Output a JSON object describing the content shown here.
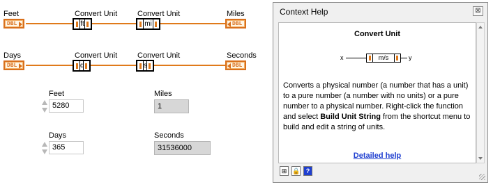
{
  "diagram": {
    "row1": {
      "input_label": "Feet",
      "node1_header": "Convert Unit",
      "node1_unit": "ft",
      "node2_header": "Convert Unit",
      "node2_unit": "mi",
      "output_label": "Miles"
    },
    "row2": {
      "input_label": "Days",
      "node1_header": "Convert Unit",
      "node1_unit": "d",
      "node2_header": "Convert Unit",
      "node2_unit": "s",
      "output_label": "Seconds"
    },
    "terminal_type": "DBL",
    "wire_color": "#e07a1a"
  },
  "front_panel": {
    "feet": {
      "label": "Feet",
      "value": "5280"
    },
    "miles": {
      "label": "Miles",
      "value": "1"
    },
    "days": {
      "label": "Days",
      "value": "365"
    },
    "seconds": {
      "label": "Seconds",
      "value": "31536000"
    }
  },
  "context_help": {
    "window_title": "Context Help",
    "heading": "Convert Unit",
    "diagram": {
      "input": "x",
      "unit": "m/s",
      "output": "y"
    },
    "desc_1": "Converts a physical number (a number that has a unit) to a pure number (a number with no units) or a pure number to a physical number. Right-click the function and select ",
    "desc_bold": "Build Unit String",
    "desc_2": " from the shortcut menu to build and edit a string of units.",
    "link": "Detailed help",
    "toolbar_icons": [
      "show-optional-terminals-icon",
      "lock-icon",
      "help-icon"
    ],
    "link_color": "#1f3fd0"
  }
}
